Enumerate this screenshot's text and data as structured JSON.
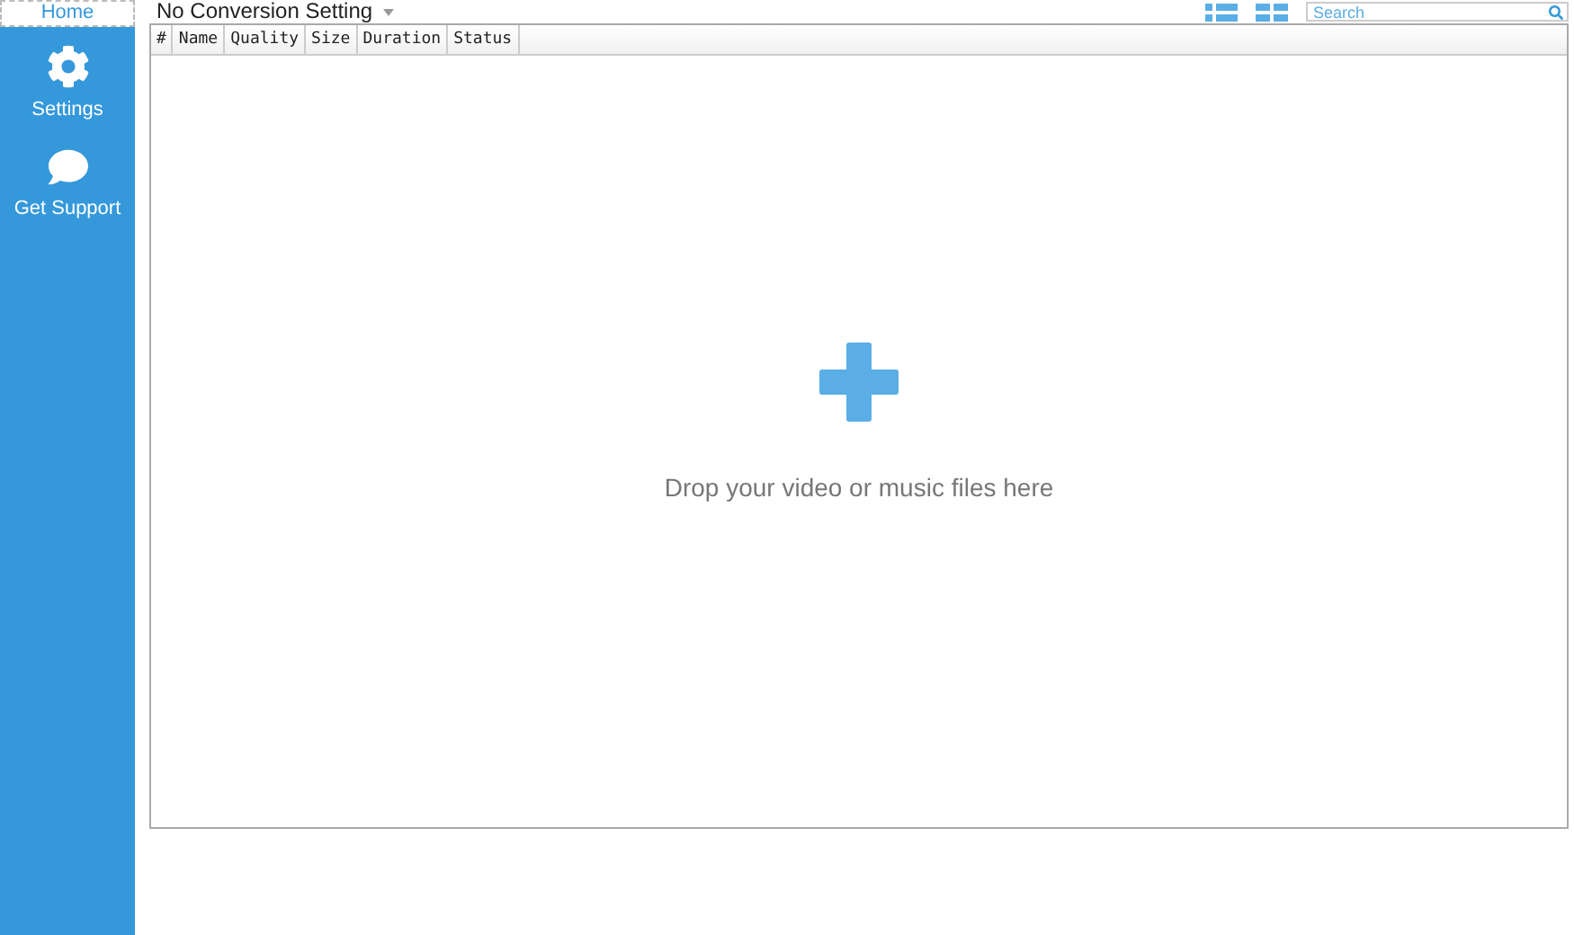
{
  "sidebar": {
    "items": [
      {
        "label": "Home",
        "kind": "tab",
        "selected": true
      },
      {
        "label": "Settings",
        "kind": "gear",
        "selected": false
      },
      {
        "label": "Get Support",
        "kind": "chat",
        "selected": false
      }
    ]
  },
  "toolbar": {
    "conversion_setting": "No Conversion Setting",
    "search": {
      "placeholder": "Search"
    }
  },
  "table": {
    "columns": [
      "#",
      "Name",
      "Quality",
      "Size",
      "Duration",
      "Status"
    ]
  },
  "drop_zone": {
    "message": "Drop your video or music files here"
  }
}
